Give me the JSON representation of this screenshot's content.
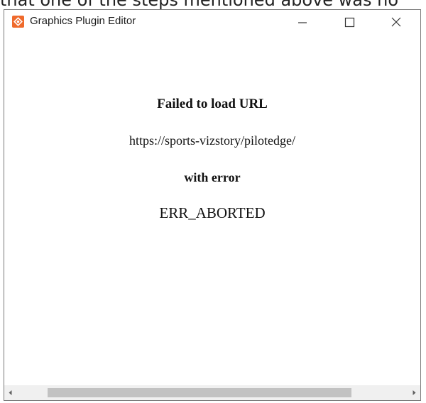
{
  "caption_fragment": "that one of the steps mentioned above was no",
  "window": {
    "title": "Graphics Plugin Editor",
    "icon": "graphics-plugin-app-icon",
    "controls": [
      "minimize-icon",
      "maximize-icon",
      "close-icon"
    ]
  },
  "error": {
    "heading": "Failed to load URL",
    "url": "https://sports-vizstory/pilotedge/",
    "with_label": "with error",
    "code": "ERR_ABORTED"
  },
  "scrollbar": {
    "orientation": "horizontal",
    "thumb_start_fraction": 0.1,
    "thumb_visible_fraction": 0.78
  },
  "colors": {
    "app_icon": "#ef6a2c",
    "scroll_thumb": "#c2c2c2",
    "scroll_track": "#f0f0f0"
  }
}
